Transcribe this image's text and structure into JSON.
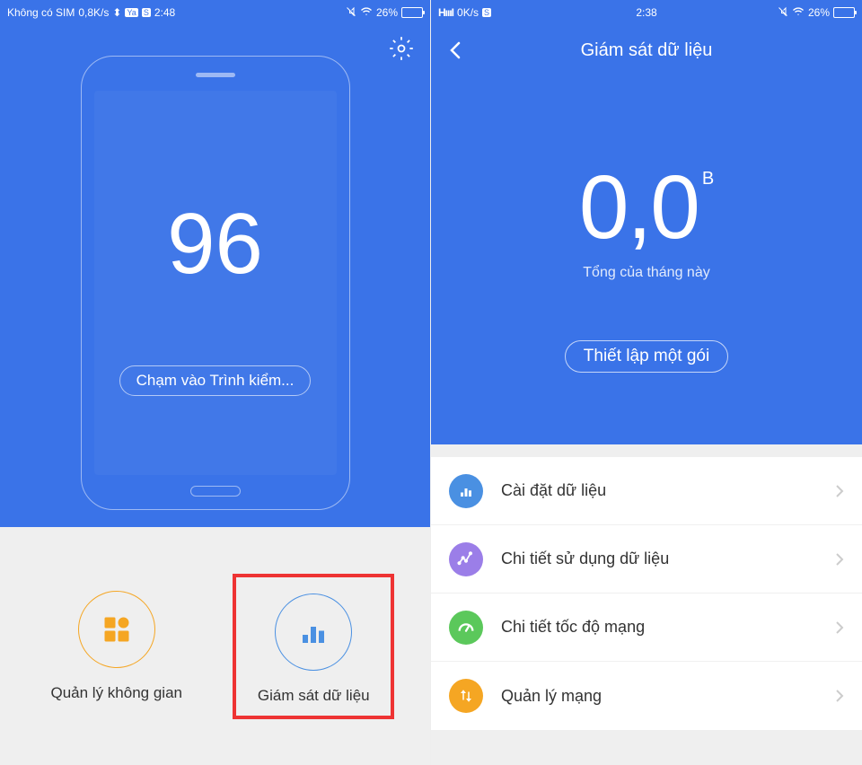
{
  "left": {
    "status": {
      "sim": "Không có SIM",
      "speed": "0,8K/s",
      "time": "2:48",
      "battery": "26%"
    },
    "score": "96",
    "tap_button": "Chạm vào Trình kiểm...",
    "actions": {
      "space": "Quản lý không gian",
      "data": "Giám sát dữ liệu"
    }
  },
  "right": {
    "status": {
      "signal": "HıııI",
      "speed": "0K/s",
      "time": "2:38",
      "battery": "26%"
    },
    "title": "Giám sát dữ liệu",
    "value": "0,0",
    "unit": "B",
    "subtitle": "Tổng của tháng này",
    "setup_button": "Thiết lập một gói",
    "items": [
      {
        "label": "Cài đặt dữ liệu"
      },
      {
        "label": "Chi tiết sử dụng dữ liệu"
      },
      {
        "label": "Chi tiết tốc độ mạng"
      },
      {
        "label": "Quản lý mạng"
      }
    ]
  }
}
